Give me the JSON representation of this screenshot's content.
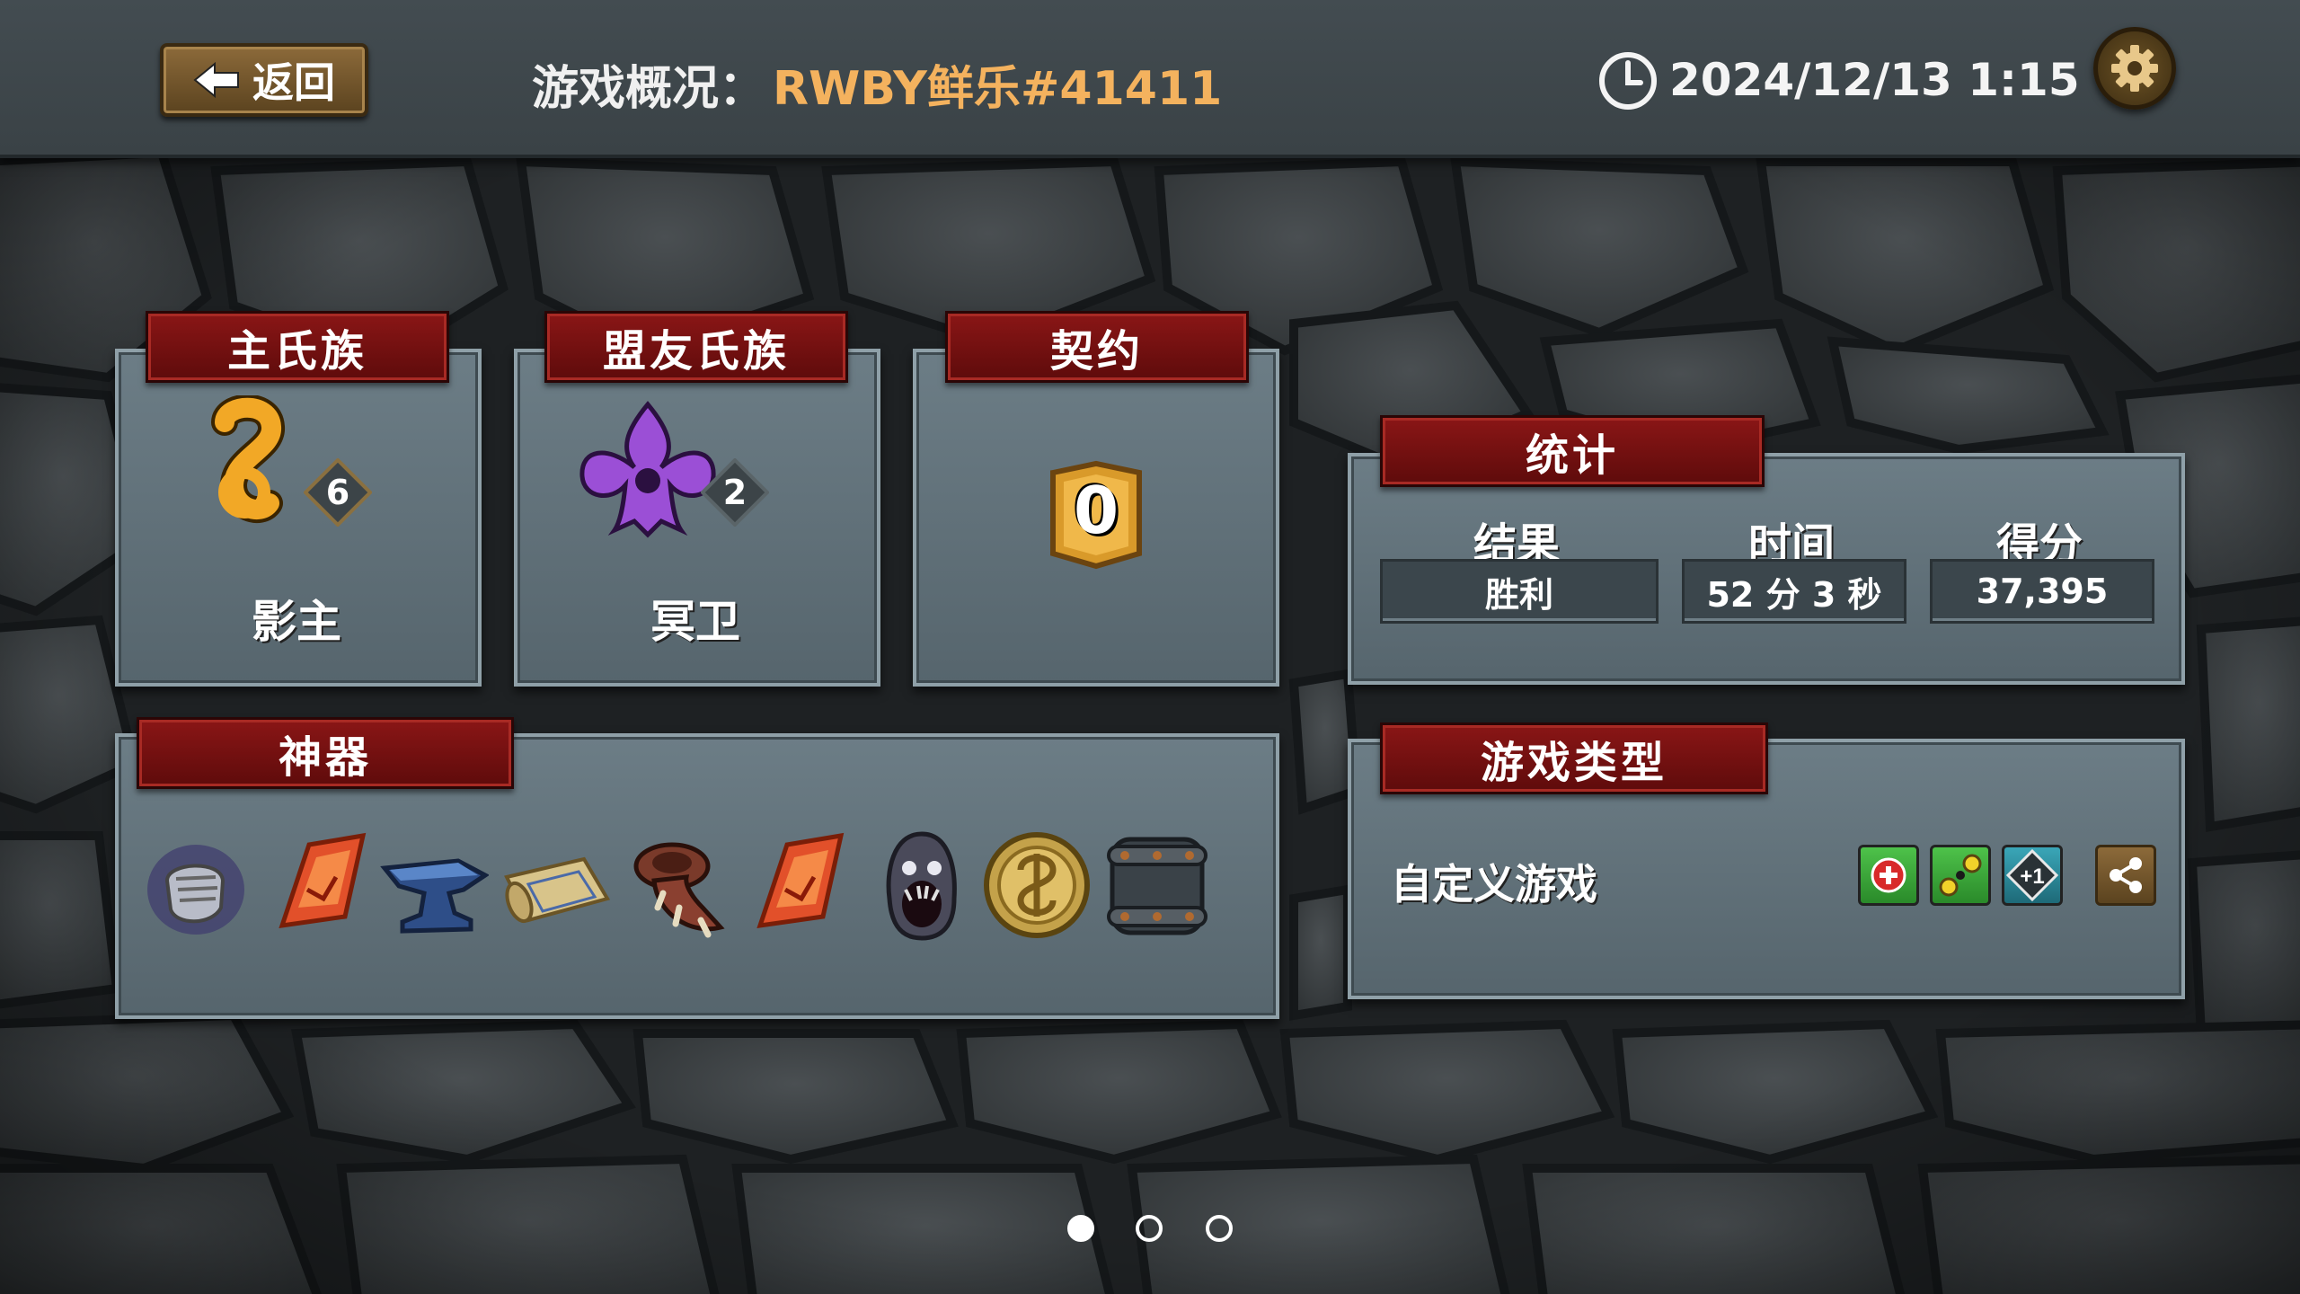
{
  "header": {
    "back_label": "返回",
    "title_label": "游戏概况：",
    "title_name": "RWBY鲜乐#41411",
    "datetime": "2024/12/13 1:15"
  },
  "main_clan": {
    "header": "主氏族",
    "name": "影主",
    "level": "6",
    "icon": "shadow-lord-sigil-icon",
    "color": "#f2a826"
  },
  "ally_clan": {
    "header": "盟友氏族",
    "name": "冥卫",
    "level": "2",
    "icon": "nether-guard-sigil-icon",
    "color": "#9b4fd6"
  },
  "pact": {
    "header": "契约",
    "value": "0"
  },
  "artifacts": {
    "header": "神器",
    "items": [
      "shadow-gauntlet-icon",
      "red-crystal-icon",
      "anvil-icon",
      "scroll-map-icon",
      "spiked-horn-icon",
      "red-crystal-icon",
      "screaming-ghost-icon",
      "golden-coin-icon",
      "iron-barrel-icon"
    ]
  },
  "stats": {
    "header": "统计",
    "result_label": "结果",
    "result_value": "胜利",
    "time_label": "时间",
    "time_value": "52 分 3 秒",
    "score_label": "得分",
    "score_value": "37,395"
  },
  "game_type": {
    "header": "游戏类型",
    "value": "自定义游戏",
    "modifiers": [
      "red-cross-health-icon",
      "gold-orbs-icon",
      "plus-one-diamond-icon"
    ]
  },
  "pagination": {
    "pages": 3,
    "active": 1
  }
}
